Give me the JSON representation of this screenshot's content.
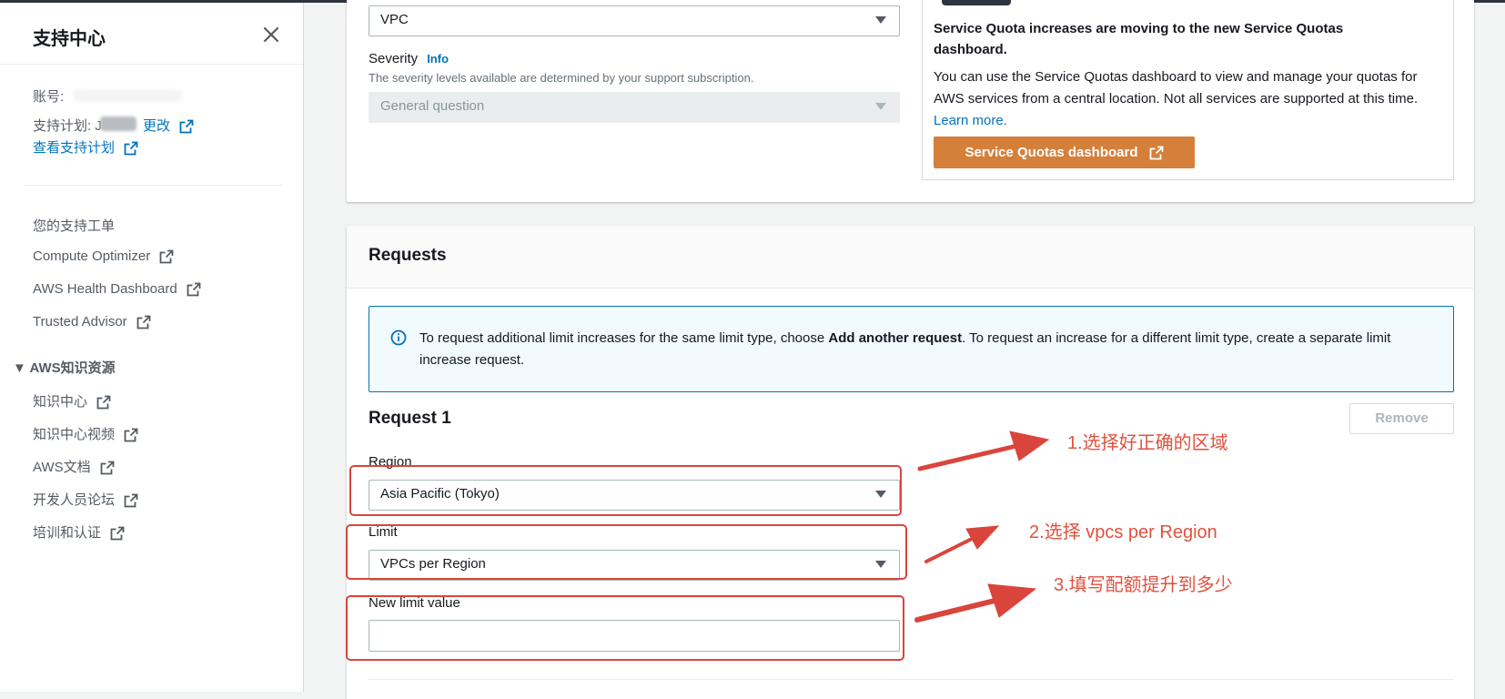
{
  "sidebar": {
    "title": "支持中心",
    "account_label": "账号:",
    "plan_label": "支持计划: J",
    "change_link": "更改",
    "view_plan_link": "查看支持计划",
    "links": [
      {
        "label": "您的支持工单",
        "external": false
      },
      {
        "label": "Compute Optimizer",
        "external": true
      },
      {
        "label": "AWS Health Dashboard",
        "external": true
      },
      {
        "label": "Trusted Advisor",
        "external": true
      }
    ],
    "section_title": "▼ AWS知识资源",
    "section_links": [
      {
        "label": "知识中心"
      },
      {
        "label": "知识中心视频"
      },
      {
        "label": "AWS文档"
      },
      {
        "label": "开发人员论坛"
      },
      {
        "label": "培训和认证"
      }
    ]
  },
  "case": {
    "service_value": "VPC",
    "severity_label": "Severity",
    "severity_info": "Info",
    "severity_desc": "The severity levels available are determined by your support subscription.",
    "severity_value": "General question"
  },
  "quota_notice": {
    "title": "Service Quota increases are moving to the new Service Quotas dashboard.",
    "body": "You can use the Service Quotas dashboard to view and manage your quotas for AWS services from a central location. Not all services are supported at this time.",
    "learn_more": "Learn more.",
    "button_label": "Service Quotas dashboard"
  },
  "requests": {
    "title": "Requests",
    "alert_part1": "To request additional limit increases for the same limit type, choose ",
    "alert_bold": "Add another request",
    "alert_part2": ". To request an increase for a different limit type, create a separate limit increase request.",
    "request_title": "Request 1",
    "remove_label": "Remove",
    "region_label": "Region",
    "region_value": "Asia Pacific (Tokyo)",
    "limit_label": "Limit",
    "limit_value": "VPCs per Region",
    "new_limit_label": "New limit value",
    "new_limit_value": ""
  },
  "annotations": {
    "step1": "1.选择好正确的区域",
    "step2": "2.选择 vpcs per Region",
    "step3": "3.填写配额提升到多少",
    "color": "#e0523f"
  },
  "colors": {
    "link": "#0073bb",
    "primary_button": "#d4803a",
    "annotation": "#d9453c"
  }
}
